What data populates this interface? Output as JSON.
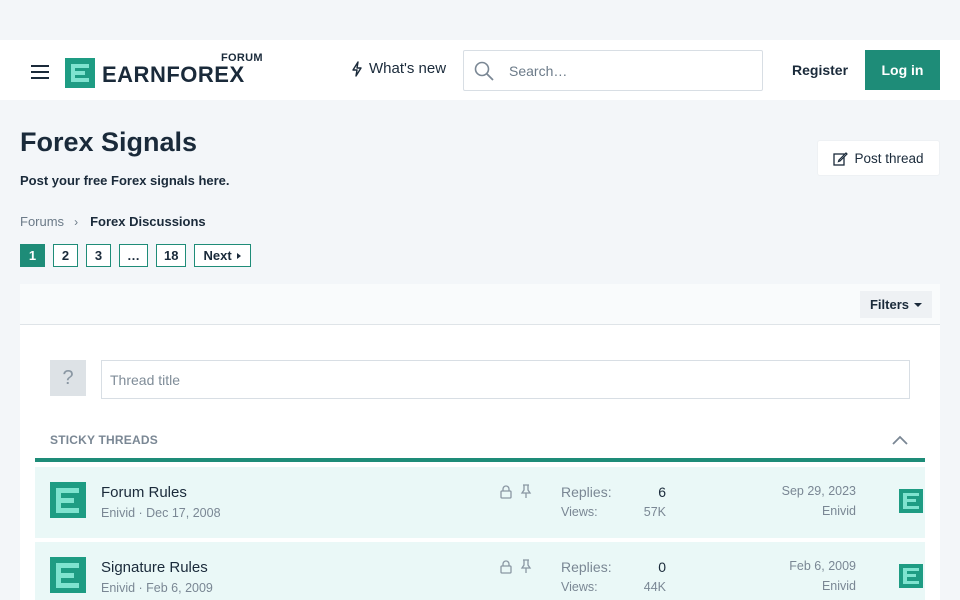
{
  "brand": {
    "logo_small": "FORUM",
    "logo_name": "EARNFOREX",
    "accent_color": "#1e8c78"
  },
  "header": {
    "whats_new": "What's new",
    "search_placeholder": "Search…",
    "register": "Register",
    "login": "Log in"
  },
  "page": {
    "title": "Forex Signals",
    "description": "Post your free Forex signals here.",
    "post_thread": "Post thread"
  },
  "breadcrumb": {
    "home": "Forums",
    "current": "Forex Discussions"
  },
  "pagination": {
    "pages": [
      "1",
      "2",
      "3",
      "…",
      "18"
    ],
    "current": "1",
    "next": "Next"
  },
  "filters": {
    "label": "Filters"
  },
  "new_thread": {
    "icon_text": "?",
    "placeholder": "Thread title"
  },
  "sticky": {
    "heading": "STICKY THREADS",
    "threads": [
      {
        "title": "Forum Rules",
        "author": "Enivid",
        "date": "Dec 17, 2008",
        "replies_label": "Replies:",
        "replies": "6",
        "views_label": "Views:",
        "views": "57K",
        "last_date": "Sep 29, 2023",
        "last_user": "Enivid"
      },
      {
        "title": "Signature Rules",
        "author": "Enivid",
        "date": "Feb 6, 2009",
        "replies_label": "Replies:",
        "replies": "0",
        "views_label": "Views:",
        "views": "44K",
        "last_date": "Feb 6, 2009",
        "last_user": "Enivid"
      }
    ]
  },
  "icons": {
    "menu": "hamburger-icon",
    "bolt": "bolt-icon",
    "search": "search-icon",
    "edit": "edit-icon",
    "chevron": "chevron-right-icon",
    "caret": "caret-down-icon",
    "lock": "lock-icon",
    "pin": "pin-icon",
    "collapse": "chevron-up-icon"
  }
}
